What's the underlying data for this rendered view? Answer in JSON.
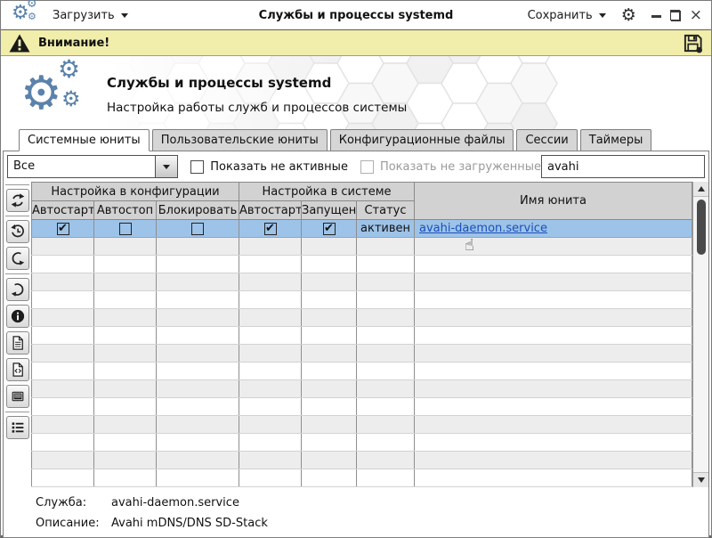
{
  "titlebar": {
    "load_label": "Загрузить",
    "title": "Службы и процессы systemd",
    "save_label": "Сохранить"
  },
  "warning_bar": {
    "label": "Внимание!"
  },
  "hero": {
    "title": "Службы и процессы systemd",
    "subtitle": "Настройка работы служб и процессов системы"
  },
  "tabs": [
    {
      "label": "Системные юниты",
      "active": true
    },
    {
      "label": "Пользовательские юниты",
      "active": false
    },
    {
      "label": "Конфигурационные файлы",
      "active": false
    },
    {
      "label": "Сессии",
      "active": false
    },
    {
      "label": "Таймеры",
      "active": false
    }
  ],
  "filter": {
    "unit_filter_value": "Все",
    "show_inactive_label": "Показать не активные",
    "show_inactive_checked": false,
    "show_unloaded_label": "Показать не загруженные",
    "show_unloaded_checked": false,
    "show_unloaded_disabled": true,
    "search_value": "avahi"
  },
  "toolbar": {
    "buttons": [
      "refresh",
      "history-restore",
      "redo",
      "undo",
      "info",
      "document",
      "document-code",
      "journal",
      "list"
    ]
  },
  "table": {
    "group_headers": {
      "config": "Настройка в конфигурации",
      "system": "Настройка в системе",
      "unit_name": "Имя юнита"
    },
    "sub_headers": [
      "Автостарт",
      "Автостоп",
      "Блокировать",
      "Автостарт",
      "Запущен",
      "Статус"
    ],
    "rows": [
      {
        "autostart_config": true,
        "autostop_config": false,
        "block_config": false,
        "autostart_system": true,
        "running_system": true,
        "status": "активен",
        "unit_name": "avahi-daemon.service",
        "selected": true
      }
    ],
    "empty_row_count": 14
  },
  "footer": {
    "service_label": "Служба:",
    "service_value": "avahi-daemon.service",
    "description_label": "Описание:",
    "description_value": "Avahi mDNS/DNS SD-Stack"
  },
  "icons": {
    "gear": "⚙",
    "check": "✔",
    "close": "×",
    "hand_cursor": "☝"
  },
  "colors": {
    "accent_blue": "#5b82ab",
    "warning_bg": "#f1eeab",
    "selected_row": "#9dc3e8",
    "link": "#1b4fbb",
    "tab_inactive": "#d6d6d6",
    "table_header": "#d2d2d2"
  }
}
